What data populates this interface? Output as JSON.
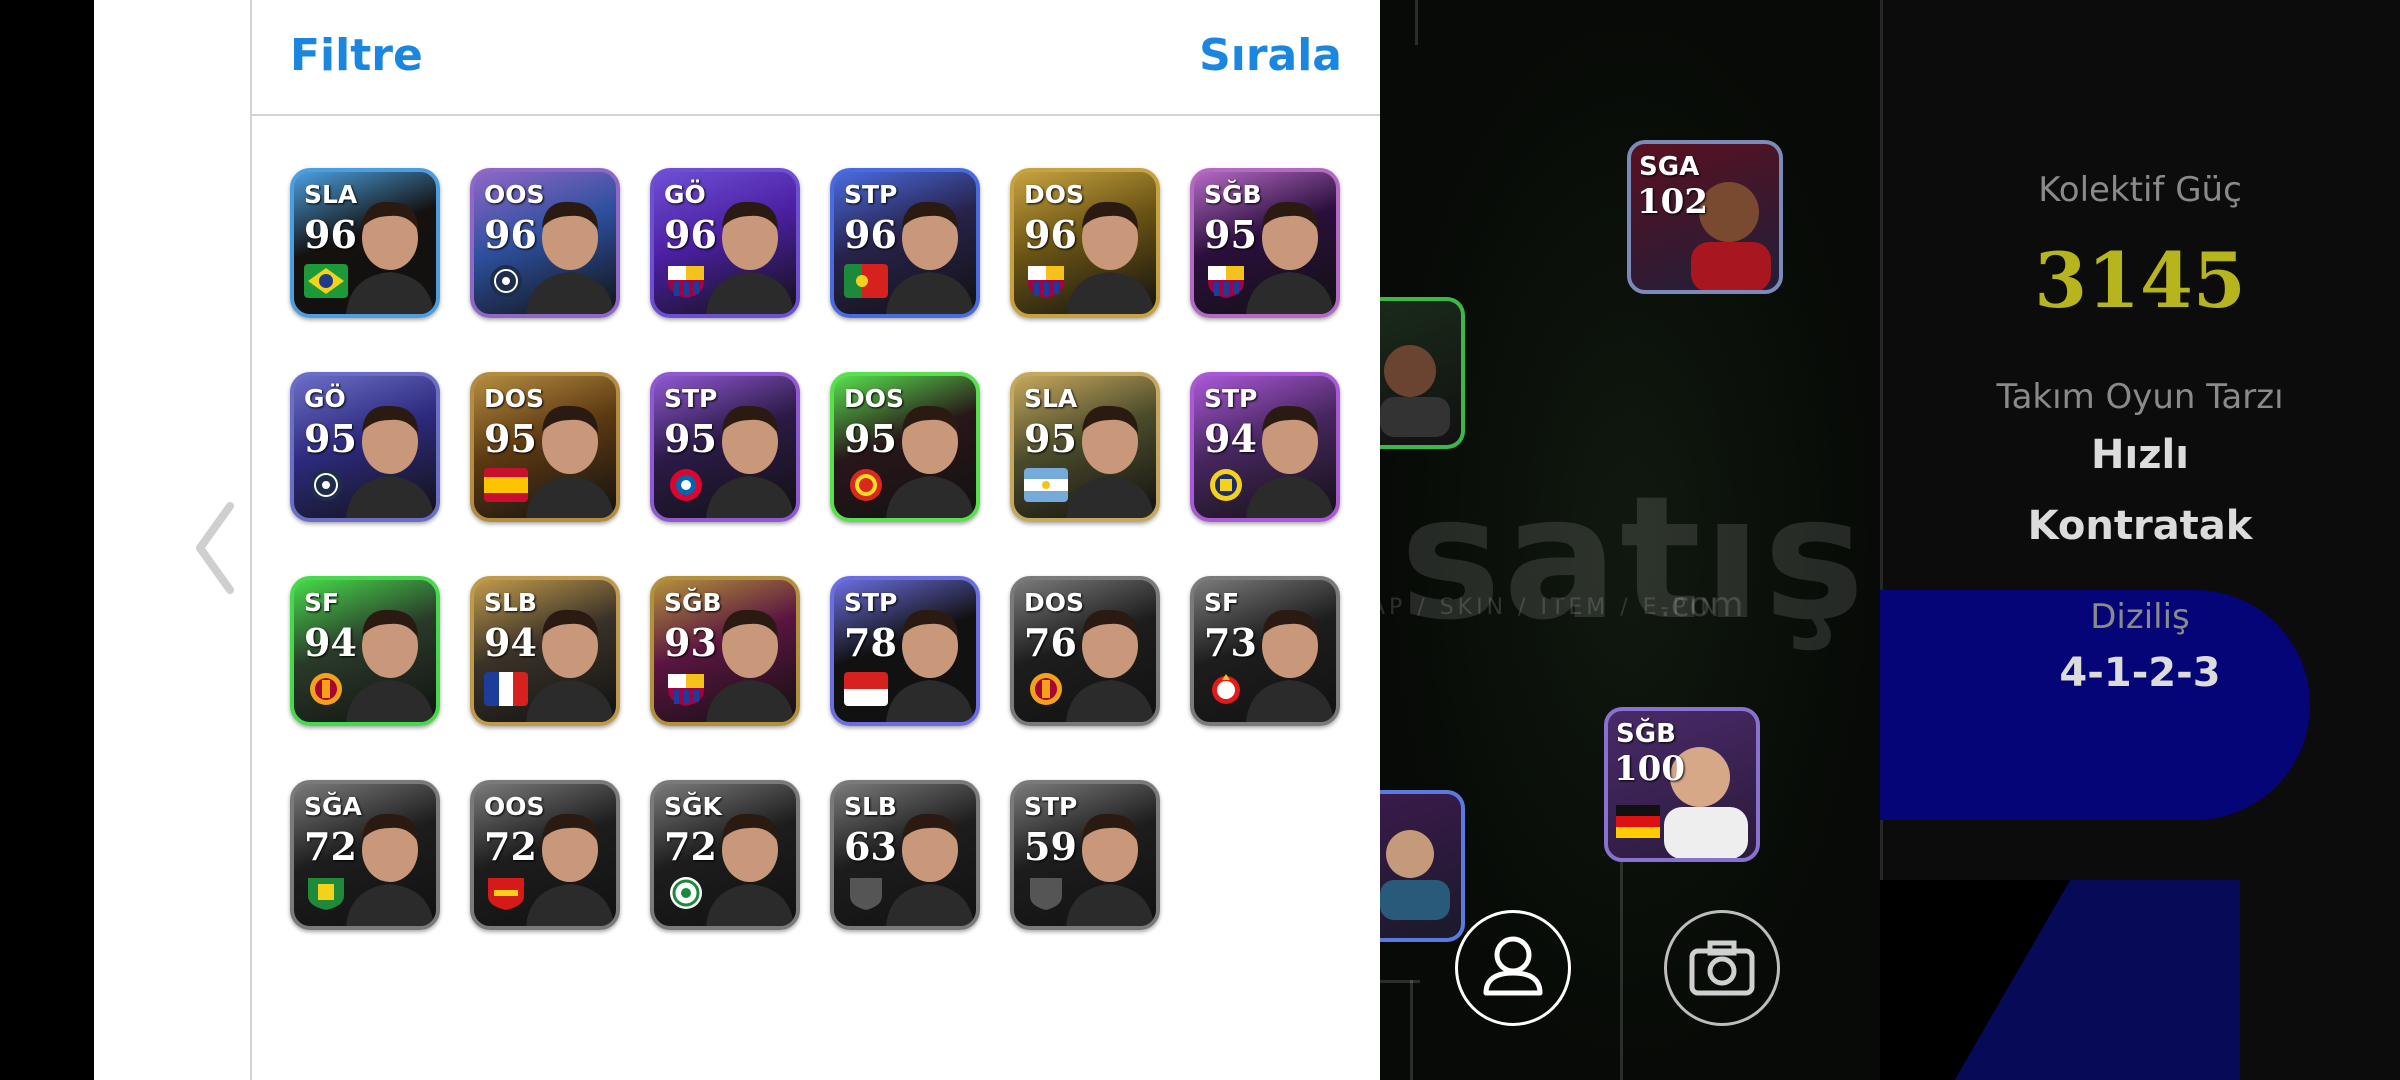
{
  "header": {
    "filter_label": "Filtre",
    "sort_label": "Sırala"
  },
  "players": [
    {
      "pos": "SLA",
      "rating": "96",
      "icon": "flag-brazil-icon",
      "frame": "#4b9fe0",
      "bg": "#14110f",
      "badge": "brazil"
    },
    {
      "pos": "OOS",
      "rating": "96",
      "icon": "club-crest-icon",
      "frame": "#8f67c7",
      "bg": "#2d4f9d",
      "badge": "crest-dark"
    },
    {
      "pos": "GÖ",
      "rating": "96",
      "icon": "club-barcelona-icon",
      "frame": "#6e4fd4",
      "bg": "#4b1fa2",
      "badge": "barca"
    },
    {
      "pos": "STP",
      "rating": "96",
      "icon": "flag-portugal-icon",
      "frame": "#4a6be0",
      "bg": "#27224a",
      "badge": "portugal"
    },
    {
      "pos": "DOS",
      "rating": "96",
      "icon": "club-barcelona-icon",
      "frame": "#c7a240",
      "bg": "#6a5414",
      "badge": "barca"
    },
    {
      "pos": "SĞB",
      "rating": "95",
      "icon": "club-barcelona-icon",
      "frame": "#b469c4",
      "bg": "#2a0f3c",
      "badge": "barca"
    },
    {
      "pos": "GÖ",
      "rating": "95",
      "icon": "club-crest-icon",
      "frame": "#6b6ec7",
      "bg": "#2d2a7d",
      "badge": "crest-dark"
    },
    {
      "pos": "DOS",
      "rating": "95",
      "icon": "flag-spain-icon",
      "frame": "#b48c40",
      "bg": "#5c3912",
      "badge": "spain"
    },
    {
      "pos": "STP",
      "rating": "95",
      "icon": "club-bayern-icon",
      "frame": "#9058d2",
      "bg": "#2b1a46",
      "badge": "bayern"
    },
    {
      "pos": "DOS",
      "rating": "95",
      "icon": "club-manutd-icon",
      "frame": "#58e04d",
      "bg": "#28161a",
      "badge": "manutd"
    },
    {
      "pos": "SLA",
      "rating": "95",
      "icon": "flag-argentina-icon",
      "frame": "#c5a75d",
      "bg": "#4b4b2b",
      "badge": "argentina"
    },
    {
      "pos": "STP",
      "rating": "94",
      "icon": "club-fenerbahce-icon",
      "frame": "#aa58d6",
      "bg": "#47265f",
      "badge": "fener"
    },
    {
      "pos": "SF",
      "rating": "94",
      "icon": "club-galatasaray-icon",
      "frame": "#47d94b",
      "bg": "#2a3a2a",
      "badge": "gala"
    },
    {
      "pos": "SLB",
      "rating": "94",
      "icon": "flag-france-icon",
      "frame": "#c09a4c",
      "bg": "#3a3228",
      "badge": "france"
    },
    {
      "pos": "SĞB",
      "rating": "93",
      "icon": "club-barcelona-icon",
      "frame": "#b2903c",
      "bg": "#5a1440",
      "badge": "barca"
    },
    {
      "pos": "STP",
      "rating": "78",
      "icon": "flag-indonesia-icon",
      "frame": "#6b6ee0",
      "bg": "#111111",
      "badge": "indonesia"
    },
    {
      "pos": "DOS",
      "rating": "76",
      "icon": "club-galatasaray-icon",
      "frame": "#7a7a7a",
      "bg": "#1d1d1d",
      "badge": "gala"
    },
    {
      "pos": "SF",
      "rating": "73",
      "icon": "club-benfica-icon",
      "frame": "#7a7a7a",
      "bg": "#1d1d1d",
      "badge": "benfica"
    },
    {
      "pos": "SĞA",
      "rating": "72",
      "icon": "club-crest-green-icon",
      "frame": "#7a7a7a",
      "bg": "#1d1d1d",
      "badge": "greencrest"
    },
    {
      "pos": "OOS",
      "rating": "72",
      "icon": "club-crest-red-icon",
      "frame": "#7a7a7a",
      "bg": "#1d1d1d",
      "badge": "redcrest"
    },
    {
      "pos": "SĞK",
      "rating": "72",
      "icon": "club-celtic-icon",
      "frame": "#7a7a7a",
      "bg": "#1d1d1d",
      "badge": "celtic"
    },
    {
      "pos": "SLB",
      "rating": "63",
      "icon": "shield-icon",
      "frame": "#7a7a7a",
      "bg": "#1d1d1d",
      "badge": "shield"
    },
    {
      "pos": "STP",
      "rating": "59",
      "icon": "shield-icon",
      "frame": "#7a7a7a",
      "bg": "#1d1d1d",
      "badge": "shield"
    }
  ],
  "pitch_cards": [
    {
      "pos": "SGA",
      "rating": "102"
    },
    {
      "pos": "SĞB",
      "rating": "100"
    }
  ],
  "watermark": {
    "main": "satış",
    "sub": "AP / SKIN / ITEM / E-PIN",
    "com": ".com"
  },
  "stats": {
    "power_label": "Kolektif Güç",
    "power_value": "3145",
    "style_label": "Takım Oyun Tarzı",
    "style_value_1": "Hızlı",
    "style_value_2": "Kontratak",
    "formation_label": "Diziliş",
    "formation_value": "4-1-2-3"
  },
  "colors": {
    "accent": "#1a86e0",
    "power": "#b7b51e",
    "blue": "#050577"
  }
}
